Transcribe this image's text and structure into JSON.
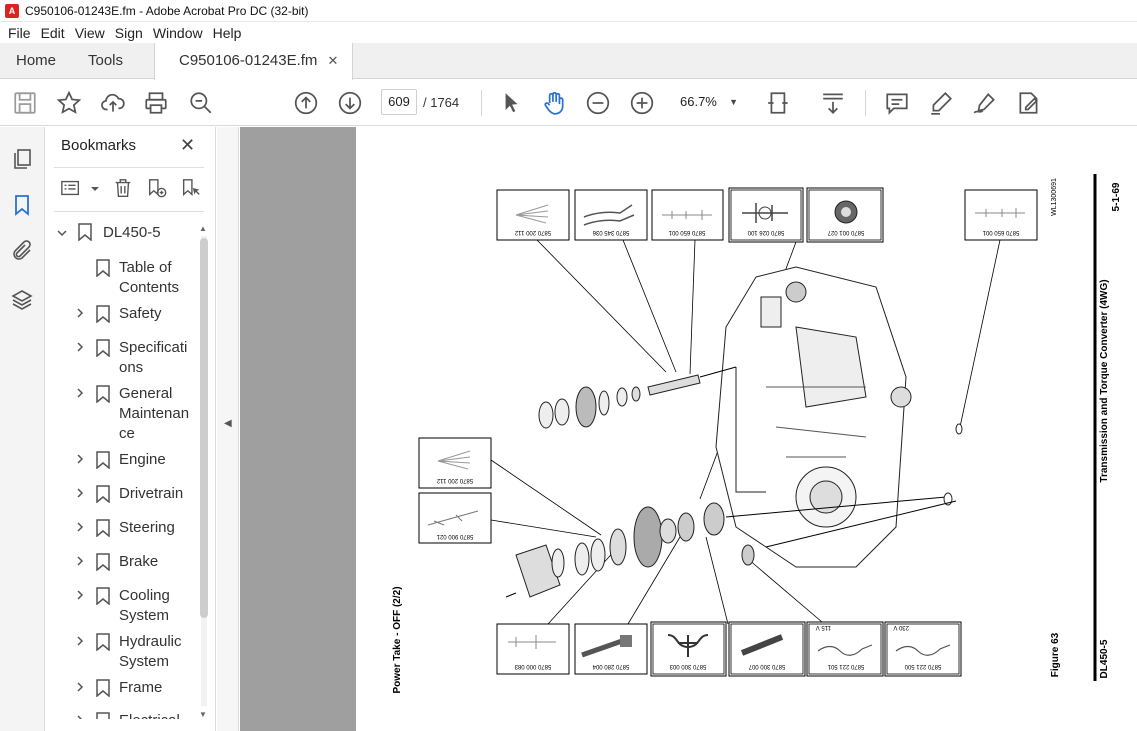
{
  "window": {
    "title": "C950106-01243E.fm - Adobe Acrobat Pro DC (32-bit)"
  },
  "menu": [
    "File",
    "Edit",
    "View",
    "Sign",
    "Window",
    "Help"
  ],
  "tabs": {
    "home": "Home",
    "tools": "Tools",
    "document": "C950106-01243E.fm"
  },
  "toolbar": {
    "page_current": "609",
    "page_total": "/ 1764",
    "zoom": "66.7%"
  },
  "bookmarks": {
    "header": "Bookmarks",
    "root": "DL450-5",
    "items": [
      {
        "label1": "Table of",
        "label2": "Contents",
        "label3": "",
        "expandable": false
      },
      {
        "label1": "Safety",
        "label2": "",
        "label3": "",
        "expandable": true
      },
      {
        "label1": "Specificati",
        "label2": "ons",
        "label3": "",
        "expandable": true
      },
      {
        "label1": "General",
        "label2": "Maintenan",
        "label3": "ce",
        "expandable": true
      },
      {
        "label1": "Engine",
        "label2": "",
        "label3": "",
        "expandable": true
      },
      {
        "label1": "Drivetrain",
        "label2": "",
        "label3": "",
        "expandable": true
      },
      {
        "label1": "Steering",
        "label2": "",
        "label3": "",
        "expandable": true
      },
      {
        "label1": "Brake",
        "label2": "",
        "label3": "",
        "expandable": true
      },
      {
        "label1": "Cooling",
        "label2": "System",
        "label3": "",
        "expandable": true
      },
      {
        "label1": "Hydraulic",
        "label2": "System",
        "label3": "",
        "expandable": true
      },
      {
        "label1": "Frame",
        "label2": "",
        "label3": "",
        "expandable": true
      },
      {
        "label1": "Electrical",
        "label2": "",
        "label3": "",
        "expandable": true
      }
    ]
  },
  "document": {
    "running_header": "Transmission and Torque Converter (4WG)",
    "page_number": "5-1-69",
    "model": "DL450-5",
    "figure": "Figure 63",
    "caption": "Power Take - OFF (2/2)",
    "drawing_id": "WL1300691",
    "tools_top": [
      "5870 200 112",
      "5870 345 036",
      "5870 650 001",
      "5870 026 100",
      "5870 001 027",
      "5870 650 001"
    ],
    "tools_left": [
      "5870 200 112",
      "5870 900 021"
    ],
    "tools_bottom": [
      "5870 000 083",
      "5870 280 004",
      "5870 300 003",
      "5870 300 007",
      "5870 221 501",
      "5870 221 500"
    ],
    "voltages": [
      "115 V",
      "230 V"
    ]
  },
  "colors": {
    "accent_blue": "#2b72d0",
    "rail_bg": "#f4f4f4",
    "gutter_gray": "#9f9f9f"
  }
}
